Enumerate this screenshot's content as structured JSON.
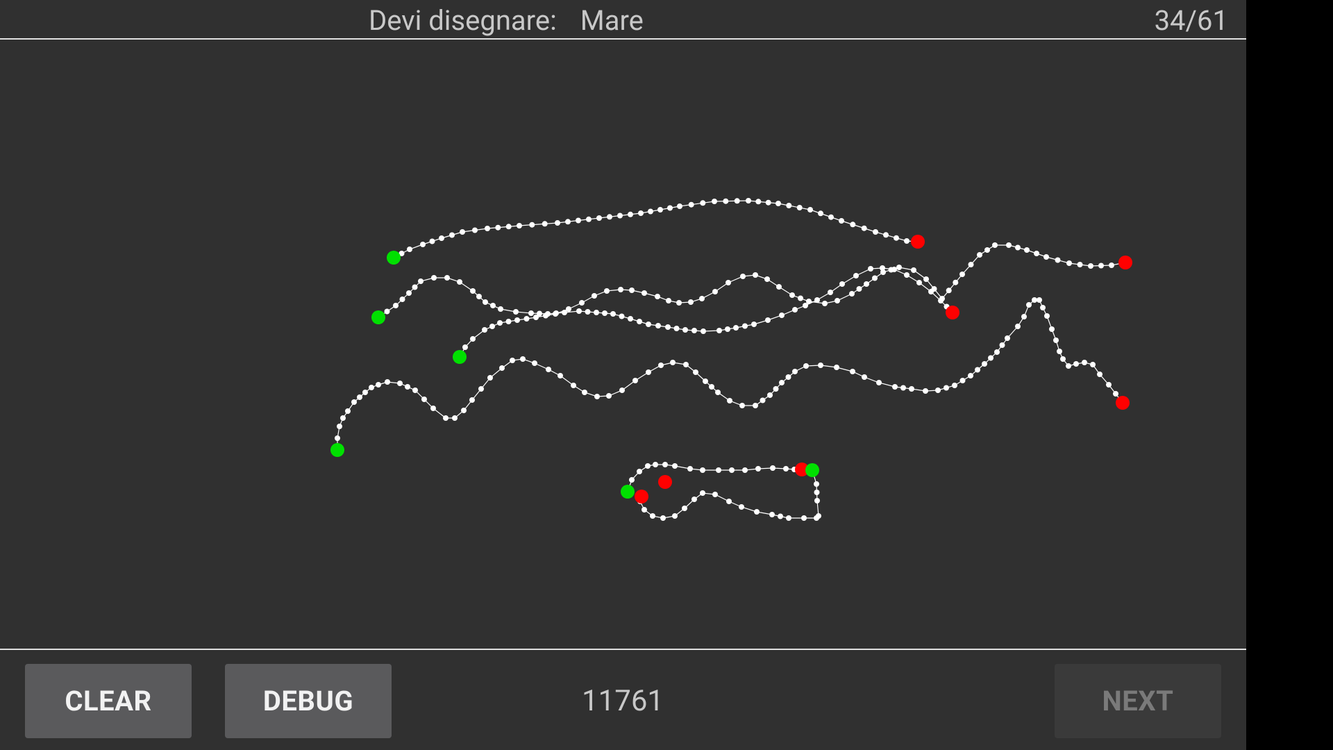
{
  "header": {
    "prompt_label": "Devi disegnare:",
    "target_word": "Mare",
    "progress": "34/61"
  },
  "footer": {
    "clear_label": "CLEAR",
    "debug_label": "DEBUG",
    "score": "11761",
    "next_label": "NEXT"
  },
  "colors": {
    "background": "#303030",
    "stroke": "#ffffff",
    "start_point": "#00e000",
    "end_point": "#ff0000",
    "button": "#5a5a5c",
    "button_disabled": "#3a3a3a"
  }
}
